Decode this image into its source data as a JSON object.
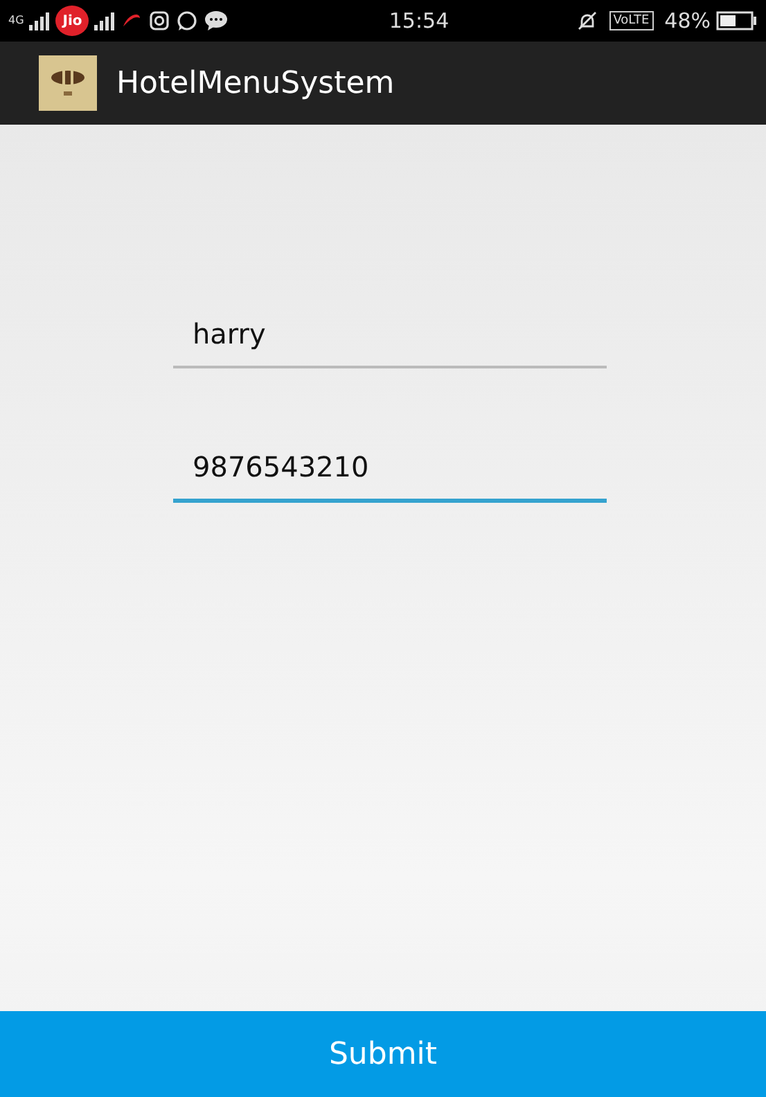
{
  "status_bar": {
    "network": "4G",
    "carrier": "Jio",
    "time": "15:54",
    "volte": "VoLTE",
    "battery": "48%"
  },
  "app_bar": {
    "title": "HotelMenuSystem"
  },
  "fields": [
    {
      "value": "harry",
      "focused": false
    },
    {
      "value": "9876543210",
      "focused": true
    }
  ],
  "submit_button": {
    "label": "Submit"
  }
}
